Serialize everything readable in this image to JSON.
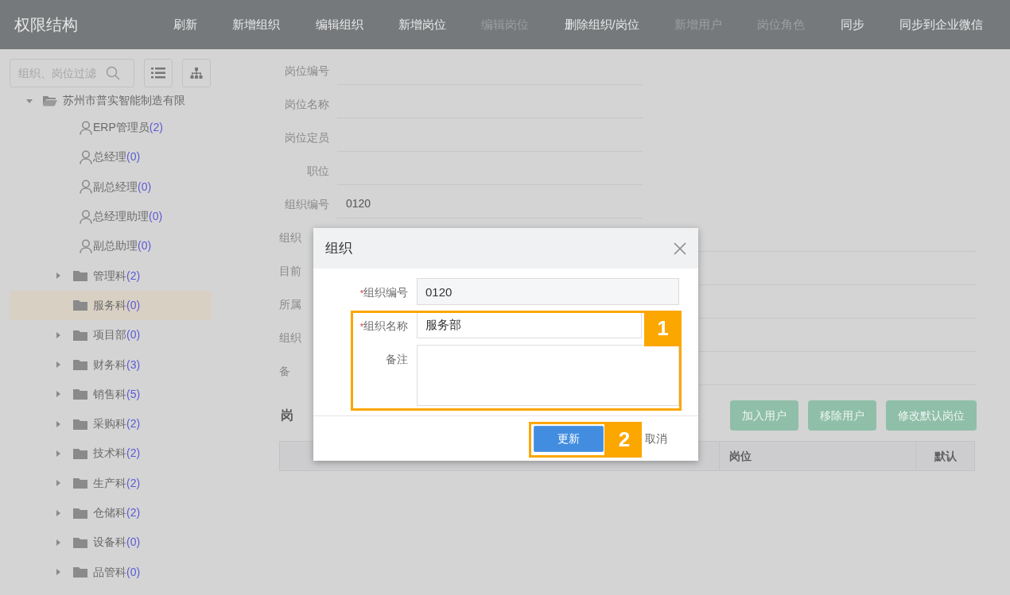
{
  "header": {
    "title": "权限结构",
    "actions": [
      {
        "label": "刷新",
        "disabled": false
      },
      {
        "label": "新增组织",
        "disabled": false
      },
      {
        "label": "编辑组织",
        "disabled": false
      },
      {
        "label": "新增岗位",
        "disabled": false
      },
      {
        "label": "编辑岗位",
        "disabled": true
      },
      {
        "label": "删除组织/岗位",
        "disabled": false
      },
      {
        "label": "新增用户",
        "disabled": true
      },
      {
        "label": "岗位角色",
        "disabled": true
      },
      {
        "label": "同步",
        "disabled": false
      },
      {
        "label": "同步到企业微信",
        "disabled": false
      }
    ]
  },
  "sidebar": {
    "search": {
      "placeholder": "组织、岗位过滤"
    },
    "tree": {
      "label": "苏州市普实智能制造有限",
      "expanded": true,
      "children": [
        {
          "kind": "person",
          "name": "ERP管理员",
          "count": "(2)",
          "selected": false,
          "expandable": false
        },
        {
          "kind": "person",
          "name": "总经理",
          "count": "(0)",
          "selected": false,
          "expandable": false
        },
        {
          "kind": "person",
          "name": "副总经理",
          "count": "(0)",
          "selected": false,
          "expandable": false
        },
        {
          "kind": "person",
          "name": "总经理助理",
          "count": "(0)",
          "selected": false,
          "expandable": false
        },
        {
          "kind": "person",
          "name": "副总助理",
          "count": "(0)",
          "selected": false,
          "expandable": false
        },
        {
          "kind": "folder",
          "name": "管理科",
          "count": "(2)",
          "selected": false,
          "expandable": true
        },
        {
          "kind": "folder",
          "name": "服务科",
          "count": "(0)",
          "selected": true,
          "expandable": false
        },
        {
          "kind": "folder",
          "name": "项目部",
          "count": "(0)",
          "selected": false,
          "expandable": true
        },
        {
          "kind": "folder",
          "name": "财务科",
          "count": "(3)",
          "selected": false,
          "expandable": true
        },
        {
          "kind": "folder",
          "name": "销售科",
          "count": "(5)",
          "selected": false,
          "expandable": true
        },
        {
          "kind": "folder",
          "name": "采购科",
          "count": "(2)",
          "selected": false,
          "expandable": true
        },
        {
          "kind": "folder",
          "name": "技术科",
          "count": "(2)",
          "selected": false,
          "expandable": true
        },
        {
          "kind": "folder",
          "name": "生产科",
          "count": "(2)",
          "selected": false,
          "expandable": true
        },
        {
          "kind": "folder",
          "name": "仓储科",
          "count": "(2)",
          "selected": false,
          "expandable": true
        },
        {
          "kind": "folder",
          "name": "设备科",
          "count": "(0)",
          "selected": false,
          "expandable": true
        },
        {
          "kind": "folder",
          "name": "品管科",
          "count": "(0)",
          "selected": false,
          "expandable": true
        }
      ]
    }
  },
  "form": {
    "fields": [
      {
        "label": "岗位编号"
      },
      {
        "label": "岗位名称"
      },
      {
        "label": "岗位定员"
      },
      {
        "label": "职位"
      },
      {
        "label": "组织编号",
        "value": "0120"
      },
      {
        "label": "组织",
        "covered": true
      },
      {
        "label": "目前",
        "covered": true
      },
      {
        "label": "所属",
        "covered": true
      },
      {
        "label": "组织",
        "covered": true
      },
      {
        "label": "备",
        "covered": true
      }
    ]
  },
  "users": {
    "heading": "岗",
    "buttons": [
      {
        "label": "加入用户",
        "disabled": true
      },
      {
        "label": "移除用户",
        "disabled": true
      },
      {
        "label": "修改默认岗位",
        "disabled": true
      }
    ],
    "columns": [
      "岗位",
      "默认"
    ]
  },
  "dialog": {
    "title": "组织",
    "fields": [
      {
        "kind": "readonly",
        "label": "组织编号",
        "required_mark": "*",
        "value": "0120"
      },
      {
        "kind": "input",
        "label": "组织名称",
        "required_mark": "*",
        "value": "服务部"
      },
      {
        "kind": "textarea",
        "label": "备注"
      }
    ],
    "primary": "更新",
    "cancel": "取消"
  },
  "annotations": [
    {
      "label": "1"
    },
    {
      "label": "2"
    }
  ]
}
